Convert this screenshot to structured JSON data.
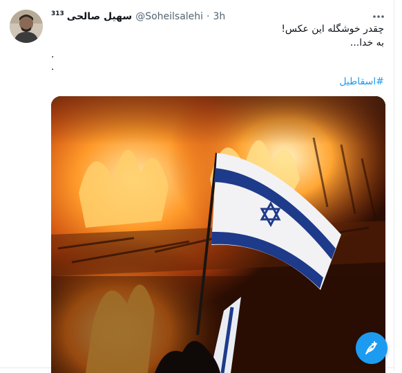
{
  "tweet": {
    "display_name": "سهیل صالحی",
    "badge": "313",
    "handle": "@Soheilsalehi",
    "separator": "·",
    "time": "3h",
    "body_lines": [
      "چقدر خوشگله این عکس!",
      "به خدا..."
    ],
    "dot_lines": [
      ".",
      "."
    ],
    "hashtag": "#اسقاطیل"
  },
  "icons": {
    "more": "more-horizontal-icon",
    "compose": "compose-feather-icon"
  },
  "colors": {
    "accent": "#1d9bf0",
    "text": "#0f1419",
    "muted": "#536471"
  }
}
